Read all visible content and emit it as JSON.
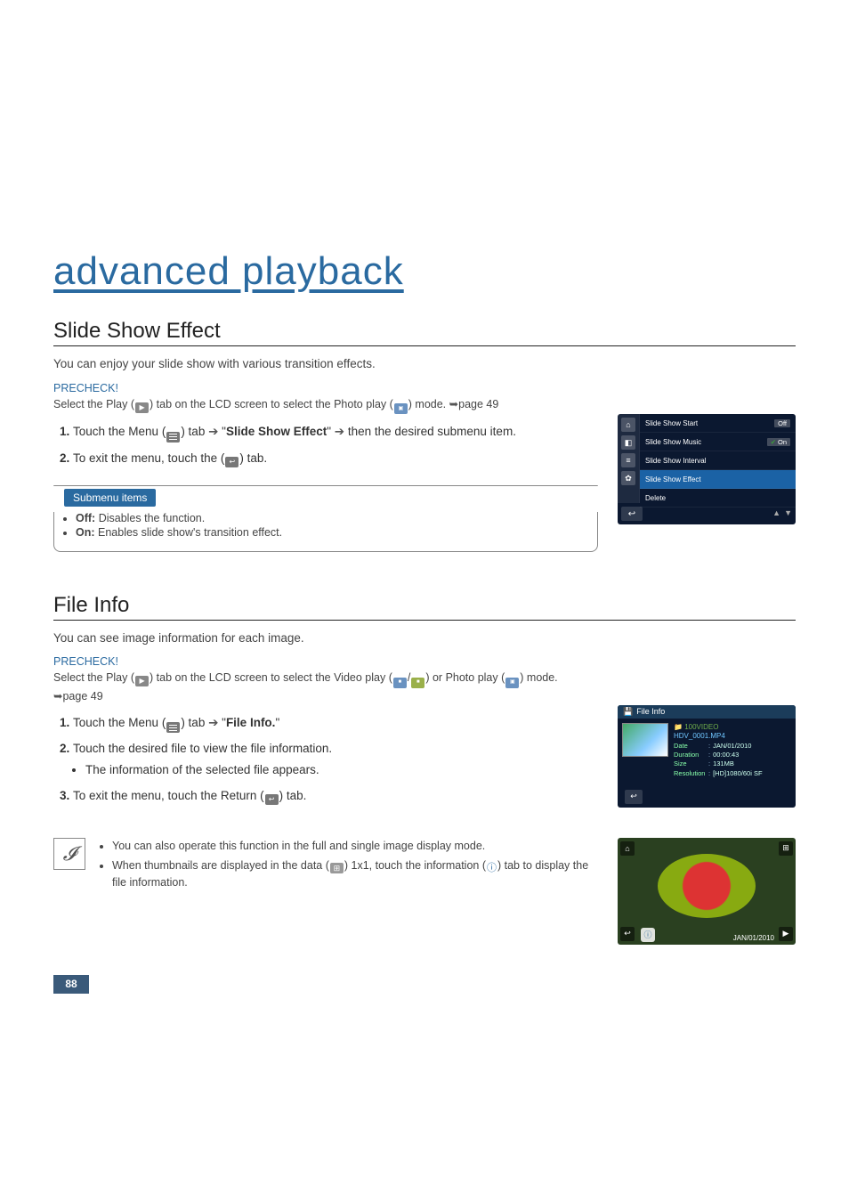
{
  "page": {
    "title": "advanced playback",
    "number": "88"
  },
  "section1": {
    "heading": "Slide Show Effect",
    "intro": "You can enjoy your slide show with various transition effects.",
    "precheck_label": "PRECHECK!",
    "precheck_pre": "Select the Play (",
    "precheck_mid": ") tab on the LCD screen to select the Photo play (",
    "precheck_post": ") mode. ",
    "precheck_ref": "page 49",
    "step1_a": "Touch the Menu (",
    "step1_b": ") tab ",
    "step1_c": " \"",
    "step1_bold": "Slide Show Effect",
    "step1_d": "\" ",
    "step1_e": " then the desired submenu item.",
    "step2_a": "To exit the menu, touch the (",
    "step2_b": ") tab.",
    "submenu_title": "Submenu items",
    "submenu_off_b": "Off:",
    "submenu_off": " Disables the function.",
    "submenu_on_b": "On:",
    "submenu_on": " Enables slide show's transition effect.",
    "lcd": {
      "r1_lbl": "Slide Show Start",
      "r1_val": "Off",
      "r2_lbl": "Slide Show Music",
      "r2_val": "On",
      "r3_lbl": "Slide Show Interval",
      "r4_lbl": "Slide Show Effect",
      "r5_lbl": "Delete"
    }
  },
  "section2": {
    "heading": "File Info",
    "intro": "You can see image information for each image.",
    "precheck_label": "PRECHECK!",
    "precheck_pre": "Select the Play (",
    "precheck_mid": ") tab on the LCD screen to select the Video play (",
    "precheck_or": ") or Photo play (",
    "precheck_post": ") mode.",
    "precheck_ref": "page 49",
    "step1_a": "Touch the Menu (",
    "step1_b": ") tab ",
    "step1_c": " \"",
    "step1_bold": "File Info.",
    "step1_d": "\"",
    "step2": "Touch the desired file to view the file information.",
    "step2_sub": "The information of the selected file appears.",
    "step3_a": "To exit the menu, touch the Return (",
    "step3_b": ") tab.",
    "lcd": {
      "header": "File Info",
      "dir": "100VIDEO",
      "fname": "HDV_0001.MP4",
      "rows": [
        {
          "k": "Date",
          "v": "JAN/01/2010"
        },
        {
          "k": "Duration",
          "v": "00:00:43"
        },
        {
          "k": "Size",
          "v": "131MB"
        },
        {
          "k": "Resolution",
          "v": "[HD]1080/60i SF"
        }
      ]
    },
    "note1": "You can also operate this function in the full and single image display mode.",
    "note2_a": "When thumbnails are displayed in the data (",
    "note2_b": ") 1x1, touch the information (",
    "note2_c": ") tab to display the file information.",
    "photo_date": "JAN/01/2010"
  },
  "arrows": {
    "right": "➔",
    "hook": "➥"
  }
}
